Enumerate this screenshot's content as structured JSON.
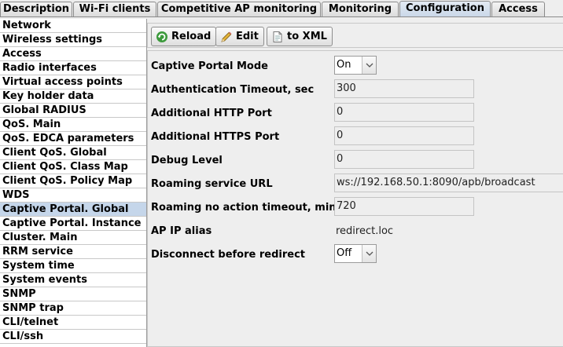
{
  "tabs": [
    {
      "label": "Description"
    },
    {
      "label": "Wi-Fi clients"
    },
    {
      "label": "Competitive AP monitoring"
    },
    {
      "label": "Monitoring"
    },
    {
      "label": "Configuration"
    },
    {
      "label": "Access"
    }
  ],
  "sidebar": {
    "items": [
      {
        "label": "Network"
      },
      {
        "label": "Wireless settings"
      },
      {
        "label": "Access"
      },
      {
        "label": "Radio interfaces"
      },
      {
        "label": "Virtual access points"
      },
      {
        "label": "Key holder data"
      },
      {
        "label": "Global RADIUS"
      },
      {
        "label": "QoS. Main"
      },
      {
        "label": "QoS. EDCA parameters"
      },
      {
        "label": "Client QoS. Global"
      },
      {
        "label": "Client QoS. Class Map"
      },
      {
        "label": "Client QoS. Policy Map"
      },
      {
        "label": "WDS"
      },
      {
        "label": "Captive Portal. Global"
      },
      {
        "label": "Captive Portal. Instance"
      },
      {
        "label": "Cluster. Main"
      },
      {
        "label": "RRM service"
      },
      {
        "label": "System time"
      },
      {
        "label": "System events"
      },
      {
        "label": "SNMP"
      },
      {
        "label": "SNMP trap"
      },
      {
        "label": "CLI/telnet"
      },
      {
        "label": "CLI/ssh"
      }
    ]
  },
  "toolbar": {
    "reload_label": "Reload",
    "edit_label": "Edit",
    "xml_label": "to XML"
  },
  "form": {
    "captive_portal_mode": {
      "label": "Captive Portal Mode",
      "value": "On"
    },
    "auth_timeout": {
      "label": "Authentication Timeout, sec",
      "value": "300"
    },
    "http_port": {
      "label": "Additional HTTP Port",
      "value": "0"
    },
    "https_port": {
      "label": "Additional HTTPS Port",
      "value": "0"
    },
    "debug_level": {
      "label": "Debug Level",
      "value": "0"
    },
    "roaming_url": {
      "label": "Roaming service URL",
      "value": "ws://192.168.50.1:8090/apb/broadcast"
    },
    "roaming_timeout": {
      "label": "Roaming no action timeout, min",
      "value": "720"
    },
    "ap_ip_alias": {
      "label": "AP IP alias",
      "value": "redirect.loc"
    },
    "disconnect": {
      "label": "Disconnect before redirect",
      "value": "Off"
    }
  },
  "colors": {
    "active_tab": "#c9d7e8",
    "selected_sidebar": "#c5d6ea"
  }
}
